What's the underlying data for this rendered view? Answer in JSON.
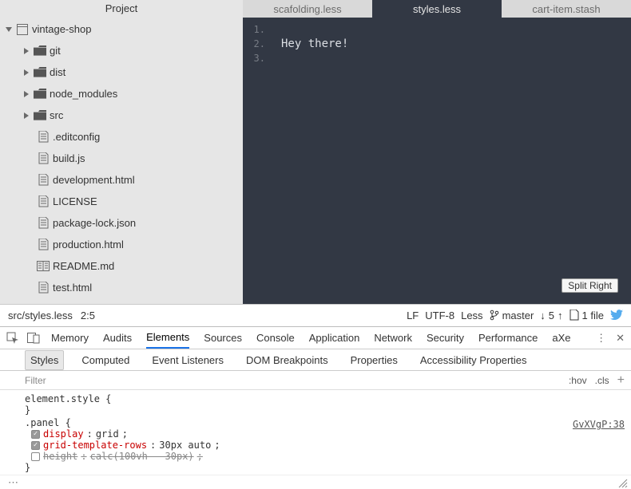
{
  "sidebar": {
    "title": "Project",
    "root": {
      "label": "vintage-shop"
    },
    "folders": [
      {
        "label": "git"
      },
      {
        "label": "dist"
      },
      {
        "label": "node_modules"
      },
      {
        "label": "src"
      }
    ],
    "files": [
      {
        "label": ".editconfig",
        "icon": "file"
      },
      {
        "label": "build.js",
        "icon": "file"
      },
      {
        "label": "development.html",
        "icon": "file"
      },
      {
        "label": "LICENSE",
        "icon": "file"
      },
      {
        "label": "package-lock.json",
        "icon": "file"
      },
      {
        "label": "production.html",
        "icon": "file"
      },
      {
        "label": " README.md",
        "icon": "md"
      },
      {
        "label": "test.html",
        "icon": "file"
      }
    ]
  },
  "tabs": [
    {
      "label": "scafolding.less",
      "active": false
    },
    {
      "label": "styles.less",
      "active": true
    },
    {
      "label": "cart-item.stash",
      "active": false
    }
  ],
  "editor": {
    "lines": [
      "",
      "Hey there!",
      ""
    ]
  },
  "tooltip": {
    "split_right": "Split Right"
  },
  "statusbar": {
    "path": "src/styles.less",
    "cursor": "2:5",
    "eol": "LF",
    "encoding": "UTF-8",
    "lang": "Less",
    "branch": "master",
    "sync": "5",
    "files": "1 file"
  },
  "devtools": {
    "menu": [
      "Memory",
      "Audits",
      "Elements",
      "Sources",
      "Console",
      "Application",
      "Network",
      "Security",
      "Performance",
      "aXe"
    ],
    "menu_active": "Elements",
    "submenu": [
      "Styles",
      "Computed",
      "Event Listeners",
      "DOM Breakpoints",
      "Properties",
      "Accessibility Properties"
    ],
    "submenu_active": "Styles",
    "filter_placeholder": "Filter",
    "hov": ":hov",
    "cls": ".cls",
    "element_style": "element.style {",
    "close_brace": "}",
    "panel_selector": ".panel {",
    "src_link": "GvXVgP:38",
    "props": [
      {
        "checked": true,
        "struck": false,
        "name": "display",
        "value": "grid"
      },
      {
        "checked": true,
        "struck": false,
        "name": "grid-template-rows",
        "value": "30px auto"
      },
      {
        "checked": false,
        "struck": true,
        "name": "height",
        "value": "calc(100vh - 30px)"
      }
    ]
  }
}
